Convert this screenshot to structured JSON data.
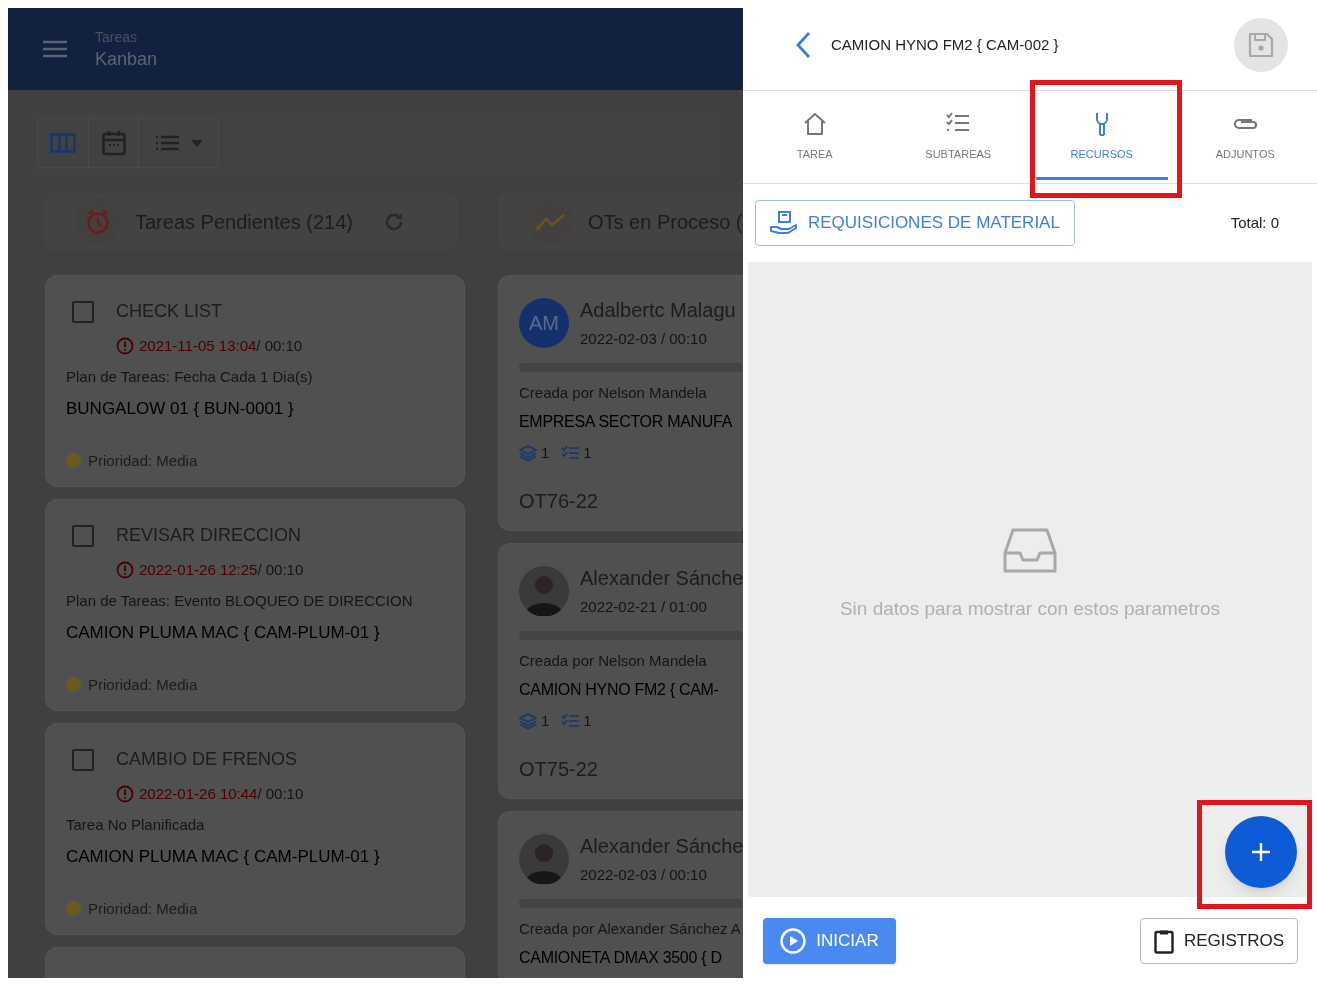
{
  "app_bar": {
    "subtitle": "Tareas",
    "title": "Kanban"
  },
  "view_toolbar": [
    {
      "kind": "columns",
      "selected": true
    },
    {
      "kind": "calendar",
      "selected": false
    },
    {
      "kind": "list",
      "selected": false
    }
  ],
  "columns": [
    {
      "kind": "pending",
      "title": "Tareas Pendientes (214)",
      "cards": [
        {
          "title": "CHECK LIST",
          "checked": false,
          "due": "2021-11-05 13:04",
          "duration": "/ 00:10",
          "plan": "Plan de Tareas: Fecha Cada 1 Dia(s)",
          "asset": "BUNGALOW 01 { BUN-0001 }",
          "priority": "Prioridad: Media"
        },
        {
          "title": "REVISAR DIRECCION",
          "checked": false,
          "due": "2022-01-26 12:25",
          "duration": "/ 00:10",
          "plan": "Plan de Tareas: Evento BLOQUEO DE DIRECCION",
          "asset": "CAMION PLUMA MAC { CAM-PLUM-01 }",
          "priority": "Prioridad: Media"
        },
        {
          "title": "CAMBIO DE FRENOS",
          "checked": false,
          "due": "2022-01-26 10:44",
          "duration": "/ 00:10",
          "plan": "Tarea No Planificada",
          "asset": "CAMION PLUMA MAC { CAM-PLUM-01 }",
          "priority": "Prioridad: Media"
        }
      ]
    },
    {
      "kind": "in_progress",
      "title": "OTs en Proceso (",
      "cards": [
        {
          "avatar": {
            "kind": "initials",
            "text": "AM"
          },
          "name": "Adalbertc Malagu",
          "date": "2022-02-03 / 00:10",
          "progress": {
            "level": 0
          },
          "created_by": "Creada por Nelson Mandela",
          "asset": "EMPRESA SECTOR MANUFA",
          "resources": "1",
          "subtasks": "1",
          "code": "OT76-22"
        },
        {
          "avatar": {
            "kind": "photo"
          },
          "name": "Alexander Sánche",
          "date": "2022-02-21 / 01:00",
          "progress": {
            "level": 0
          },
          "created_by": "Creada por Nelson Mandela",
          "asset": "CAMION HYNO FM2 { CAM-",
          "resources": "1",
          "subtasks": "1",
          "code": "OT75-22"
        },
        {
          "avatar": {
            "kind": "photo"
          },
          "name": "Alexander Sánche",
          "date": "2022-02-03 / 00:10",
          "progress": {
            "level": 0
          },
          "created_by": "Creada por Alexander Sánchez A",
          "asset": "CAMIONETA DMAX 3500 { D"
        }
      ]
    }
  ],
  "panel": {
    "title": "CAMION HYNO FM2 { CAM-002 }",
    "tabs": [
      {
        "kind": "home",
        "label": "TAREA",
        "selected": false
      },
      {
        "kind": "checklist",
        "label": "SUBTAREAS",
        "selected": false
      },
      {
        "kind": "wrench",
        "label": "RECURSOS",
        "selected": true
      },
      {
        "kind": "clip",
        "label": "ADJUNTOS",
        "selected": false
      }
    ],
    "requisitions_button": "REQUISICIONES DE MATERIAL",
    "total": "Total: 0",
    "empty_message": "Sin datos para mostrar con estos parametros",
    "footer": {
      "start_button": "INICIAR",
      "records_button": "REGISTROS"
    }
  }
}
